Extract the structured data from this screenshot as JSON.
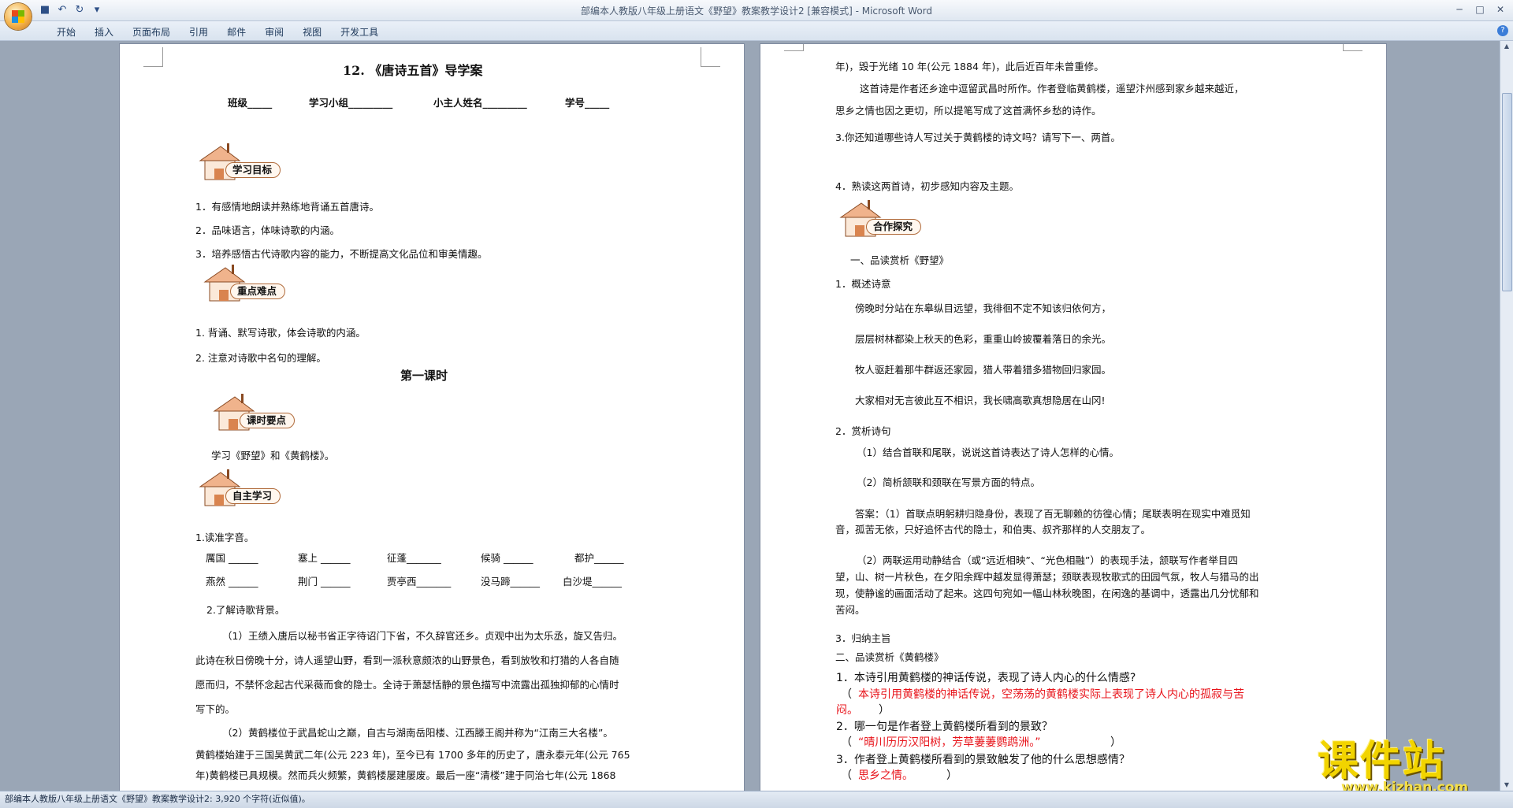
{
  "window": {
    "title": "部编本人教版八年级上册语文《野望》教案教学设计2 [兼容模式] - Microsoft Word"
  },
  "menu_tabs": [
    "开始",
    "插入",
    "页面布局",
    "引用",
    "邮件",
    "审阅",
    "视图",
    "开发工具"
  ],
  "status_bar": {
    "text": "部编本人教版八年级上册语文《野望》教案教学设计2: 3,920 个字符(近似值)。"
  },
  "left_page": {
    "title": "12. 《唐诗五首》导学案",
    "header_fields": [
      "班级_____",
      "学习小组_________",
      "小主人姓名_________",
      "学号_____"
    ],
    "badge_goals": "学习目标",
    "goals": [
      "1．有感情地朗读并熟练地背诵五首唐诗。",
      "2．品味语言，体味诗歌的内涵。",
      "3．培养感悟古代诗歌内容的能力，不断提高文化品位和审美情趣。"
    ],
    "badge_key": "重点难点",
    "key_points": [
      "1. 背诵、默写诗歌，体会诗歌的内涵。",
      "2. 注意对诗歌中名句的理解。"
    ],
    "lesson_title": "第一课时",
    "badge_lesson": "课时要点",
    "lesson_point": "学习《野望》和《黄鹤楼》。",
    "badge_self": "自主学习",
    "read_title": "1.读准字音。",
    "read_row1": [
      "厲国 ______",
      "塞上 ______",
      "征蓬_______",
      "候骑 ______",
      "都护______"
    ],
    "read_row2": [
      "燕然 ______",
      "荆门 ______",
      "贾亭西_______",
      "没马蹄______",
      "白沙堤______"
    ],
    "bg_title": "2.了解诗歌背景。",
    "bg_p1": [
      "（1）王绩入唐后以秘书省正字待诏门下省，不久辞官还乡。贞观中出为太乐丞，旋又告归。",
      "此诗在秋日傍晚十分，诗人遥望山野，看到一派秋意颇浓的山野景色，看到放牧和打猎的人各自随",
      "愿而归，不禁怀念起古代采薇而食的隐士。全诗于萧瑟恬静的景色描写中流露出孤独抑郁的心情时",
      "写下的。"
    ],
    "bg_p2": [
      "（2）黄鹤楼位于武昌蛇山之巅，自古与湖南岳阳楼、江西滕王阁并称为“江南三大名楼”。",
      "黄鹤楼始建于三国吴黄武二年(公元 223 年)，至今已有 1700 多年的历史了，唐永泰元年(公元 765",
      "年)黄鹤楼已具规模。然而兵火频繁，黄鹤楼屡建屡废。最后一座“清楼”建于同治七年(公元 1868"
    ]
  },
  "right_page": {
    "cont1": "年)，毁于光绪 10 年(公元 1884 年)，此后近百年未曾重修。",
    "cont2a": "这首诗是作者还乡途中逗留武昌时所作。作者登临黄鹤楼，遥望汴州感到家乡越来越近，",
    "cont2b": "思乡之情也因之更切，所以提笔写成了这首满怀乡愁的诗作。",
    "q3": "3.你还知道哪些诗人写过关于黄鹤楼的诗文吗？请写下一、两首。",
    "q4": "4．熟读这两首诗，初步感知内容及主题。",
    "badge_coop": "合作探究",
    "sec1": "一、品读赏析《野望》",
    "s1_title": "1．概述诗意",
    "s1_lines": [
      "傍晚时分站在东皋纵目远望，我徘徊不定不知该归依何方，",
      "层层树林都染上秋天的色彩，重重山岭披覆着落日的余光。",
      "牧人驱赶着那牛群返还家园，猎人带着猎多猎物回归家园。",
      "大家相对无言彼此互不相识，我长啸高歌真想隐居在山冈!"
    ],
    "s2_title": "2．赏析诗句",
    "s2_q1": "（1）结合首联和尾联，说说这首诗表达了诗人怎样的心情。",
    "s2_q2": "（2）简析颔联和颈联在写景方面的特点。",
    "ans1a": "答案：（1）首联点明躬耕归隐身份，表现了百无聊赖的彷徨心情；尾联表明在现实中难觅知",
    "ans1b": "音，孤苦无依，只好追怀古代的隐士，和伯夷、叔齐那样的人交朋友了。",
    "ans2": [
      "（2）两联运用动静结合（或“远近相映”、“光色相融”）的表现手法，颔联写作者举目四",
      "望，山、树一片秋色，在夕阳余辉中越发显得萧瑟；颈联表现牧歌式的田园气氛，牧人与猎马的出",
      "现，使静谧的画面活动了起来。这四句宛如一幅山林秋晚图，在闲逸的基调中，透露出几分忧郁和",
      "苦闷。"
    ],
    "s3": "3．归纳主旨",
    "sec2": "二、品读赏析《黄鹤楼》",
    "hq1": "1．本诗引用黄鹤楼的神话传说，表现了诗人内心的什么情感?",
    "ha1_open": "（",
    "ha1a": "本诗引用黄鹤楼的神话传说，空荡荡的黄鹤楼实际上表现了诗人内心的孤寂与苦",
    "ha1b": "闷。",
    "ha1_close": "）",
    "hq2": "2．哪一句是作者登上黄鹤楼所看到的景致？",
    "ha2_open": "（",
    "ha2": "“晴川历历汉阳树，芳草萋萋鹦鹉洲。”",
    "ha2_close": "）",
    "hq3": "3．作者登上黄鹤楼所看到的景致触发了他的什么思想感情？",
    "ha3_open": "（",
    "ha3": "思乡之情。",
    "ha3_close": "）"
  },
  "watermark": {
    "text": "课件站",
    "url": "www.kjzhan.com"
  },
  "colors": {
    "answer_red": "#e8141b",
    "ribbon": "#dfe7f1",
    "watermark_yellow": "#f2d400"
  }
}
